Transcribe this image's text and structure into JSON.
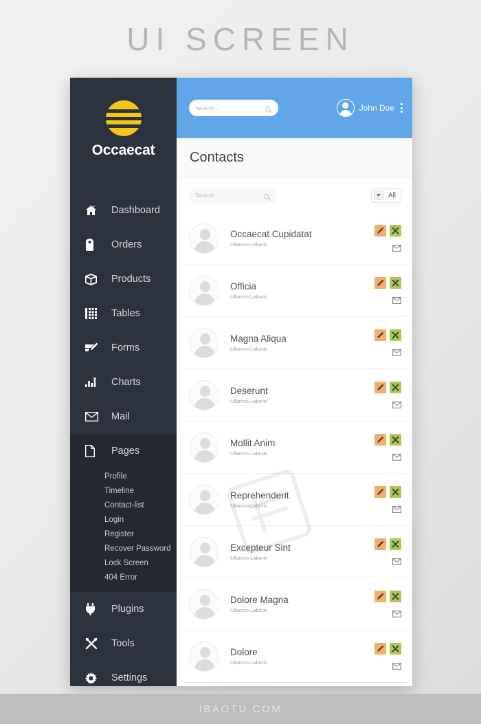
{
  "poster": {
    "title": "UI SCREEN",
    "footer": "IBAOTU.COM"
  },
  "colors": {
    "sidebar_bg": "#2b313d",
    "sidebar_active": "#232833",
    "header_blue": "#62a6ea",
    "logo_yellow": "#f5c518",
    "edit_orange": "#f5ad6b",
    "delete_green": "#a9c94f",
    "page_bg": "#f4f4f4"
  },
  "sidebar": {
    "brand": "Occaecat",
    "logo_icon": "striped-circle-logo",
    "items": [
      {
        "label": "Dashboard",
        "icon": "home-icon",
        "active": false
      },
      {
        "label": "Orders",
        "icon": "tag-icon",
        "active": false
      },
      {
        "label": "Products",
        "icon": "box-icon",
        "active": false
      },
      {
        "label": "Tables",
        "icon": "grid-icon",
        "active": false
      },
      {
        "label": "Forms",
        "icon": "pencil-form-icon",
        "active": false
      },
      {
        "label": "Charts",
        "icon": "bar-chart-icon",
        "active": false
      },
      {
        "label": "Mail",
        "icon": "envelope-icon",
        "active": false
      },
      {
        "label": "Pages",
        "icon": "page-icon",
        "active": true
      },
      {
        "label": "Plugins",
        "icon": "plug-icon",
        "active": false
      },
      {
        "label": "Tools",
        "icon": "tools-icon",
        "active": false
      },
      {
        "label": "Settings",
        "icon": "gear-icon",
        "active": false
      }
    ],
    "submenu": [
      "Profile",
      "Timeline",
      "Contact-list",
      "Login",
      "Register",
      "Recover Password",
      "Lock Screen",
      "404 Error"
    ]
  },
  "topbar": {
    "search_placeholder": "Search...",
    "search_value": "",
    "search_icon": "search-icon",
    "user_name": "John Doe",
    "avatar_icon": "user-avatar-icon",
    "menu_icon": "vertical-dots-icon"
  },
  "page": {
    "title": "Contacts"
  },
  "toolbar": {
    "search_placeholder": "Search...",
    "search_value": "",
    "search_icon": "search-icon",
    "filter_label": "All",
    "filter_icon": "chevron-down-icon"
  },
  "row_actions": {
    "edit_icon": "pencil-icon",
    "delete_icon": "close-x-icon",
    "mail_icon": "envelope-icon"
  },
  "contacts": [
    {
      "name": "Occaecat Cupidatat",
      "subtitle": "Ullamco Laboris"
    },
    {
      "name": "Officia",
      "subtitle": "Ullamco Laboris"
    },
    {
      "name": "Magna Aliqua",
      "subtitle": "Ullamco Laboris"
    },
    {
      "name": "Deserunt",
      "subtitle": "Ullamco Laboris"
    },
    {
      "name": "Mollit Anim",
      "subtitle": "Ullamco Laboris"
    },
    {
      "name": "Reprehenderit",
      "subtitle": "Ullamco Laboris"
    },
    {
      "name": "Excepteur Sint",
      "subtitle": "Ullamco Laboris"
    },
    {
      "name": "Dolore Magna",
      "subtitle": "Ullamco Laboris"
    },
    {
      "name": "Dolore",
      "subtitle": "Ullamco Laboris"
    }
  ]
}
